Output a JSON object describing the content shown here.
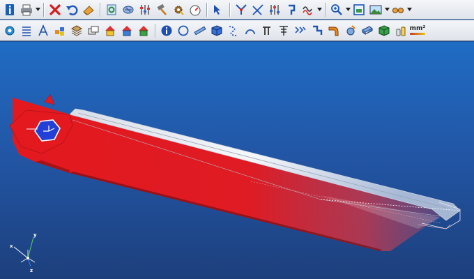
{
  "colors": {
    "part_red": "#e3191f",
    "part_white": "#f3f6fa",
    "hex_blue": "#2340d6",
    "viewport_top": "#1f6cc4",
    "viewport_bottom": "#1d3f7c"
  },
  "toolbar_row1": {
    "icons": [
      "info-icon",
      "print-icon",
      "dropdown-arrow-icon",
      "delete-icon",
      "undo-icon",
      "eraser-icon",
      "regenerate-icon",
      "hatch-icon",
      "sliders-icon",
      "hammer-icon",
      "gear-wrench-icon",
      "gauge-icon",
      "select-arrow-icon",
      "split-icon",
      "line-tool-icon",
      "sliders-alt-icon",
      "hook-icon",
      "wave-icon",
      "dropdown-arrow-icon",
      "zoom-icon",
      "dropdown-arrow-icon",
      "fit-view-icon",
      "image-icon",
      "dropdown-arrow-icon",
      "glasses-icon",
      "dropdown-arrow-icon"
    ]
  },
  "toolbar_row2": {
    "icons": [
      "settings-icon",
      "list-icon",
      "text-a-icon",
      "materials-icon",
      "layers-icon",
      "copy-icon",
      "house-yellow-icon",
      "house-blue-icon",
      "house-green-icon",
      "info-circle-icon",
      "circle-icon",
      "ruler-icon",
      "cube-icon",
      "dotted-curve-icon",
      "arc-icon",
      "snap-icon",
      "t-icon",
      "spring-icon",
      "profile-icon",
      "elbow-icon",
      "weld-icon",
      "plate-icon",
      "green-cube-icon",
      "bottles-icon",
      "area-icon"
    ],
    "area_label": "mm²"
  },
  "triad": {
    "x_label": "x",
    "y_label": "y",
    "z_label": "z"
  }
}
